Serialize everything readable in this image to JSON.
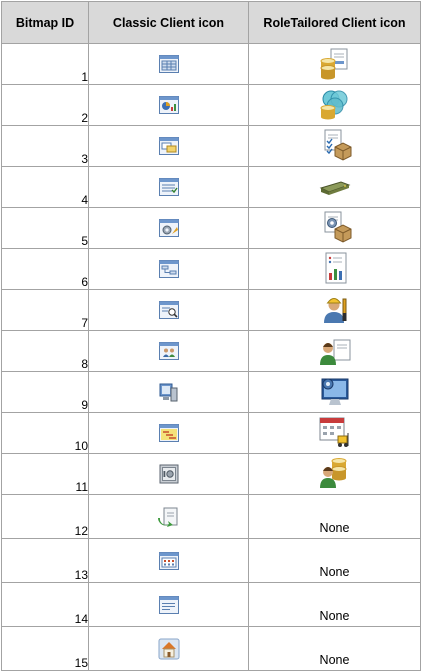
{
  "table": {
    "headers": [
      "Bitmap ID",
      "Classic Client icon",
      "RoleTailored Client icon"
    ],
    "rows": [
      {
        "id": "1",
        "classic_icon": "grid-form-icon",
        "rt_icon": "database-documents-icon",
        "rt_text": ""
      },
      {
        "id": "2",
        "classic_icon": "chart-report-icon",
        "rt_icon": "database-venn-icon",
        "rt_text": ""
      },
      {
        "id": "3",
        "classic_icon": "card-window-icon",
        "rt_icon": "checklist-box-icon",
        "rt_text": ""
      },
      {
        "id": "4",
        "classic_icon": "list-window-icon",
        "rt_icon": "server-device-icon",
        "rt_text": ""
      },
      {
        "id": "5",
        "classic_icon": "gear-window-icon",
        "rt_icon": "gear-box-icon",
        "rt_text": ""
      },
      {
        "id": "6",
        "classic_icon": "flowchart-icon",
        "rt_icon": "bar-chart-page-icon",
        "rt_text": ""
      },
      {
        "id": "7",
        "classic_icon": "magnifier-window-icon",
        "rt_icon": "worker-tools-icon",
        "rt_text": ""
      },
      {
        "id": "8",
        "classic_icon": "users-window-icon",
        "rt_icon": "people-document-icon",
        "rt_text": ""
      },
      {
        "id": "9",
        "classic_icon": "computer-window-icon",
        "rt_icon": "monitor-gear-icon",
        "rt_text": ""
      },
      {
        "id": "10",
        "classic_icon": "gantt-icon",
        "rt_icon": "calendar-forklift-icon",
        "rt_text": ""
      },
      {
        "id": "11",
        "classic_icon": "safe-icon",
        "rt_icon": "user-database-icon",
        "rt_text": ""
      },
      {
        "id": "12",
        "classic_icon": "document-arrow-icon",
        "rt_icon": "",
        "rt_text": "None"
      },
      {
        "id": "13",
        "classic_icon": "calendar-window-icon",
        "rt_icon": "",
        "rt_text": "None"
      },
      {
        "id": "14",
        "classic_icon": "form-window-icon",
        "rt_icon": "",
        "rt_text": "None"
      },
      {
        "id": "15",
        "classic_icon": "home-icon",
        "rt_icon": "",
        "rt_text": "None"
      }
    ]
  },
  "colors": {
    "header_bg": "#d9d9d9",
    "border": "#a3a3a3",
    "icon_blue": "#4f7fb8",
    "icon_gold": "#d9a832"
  }
}
